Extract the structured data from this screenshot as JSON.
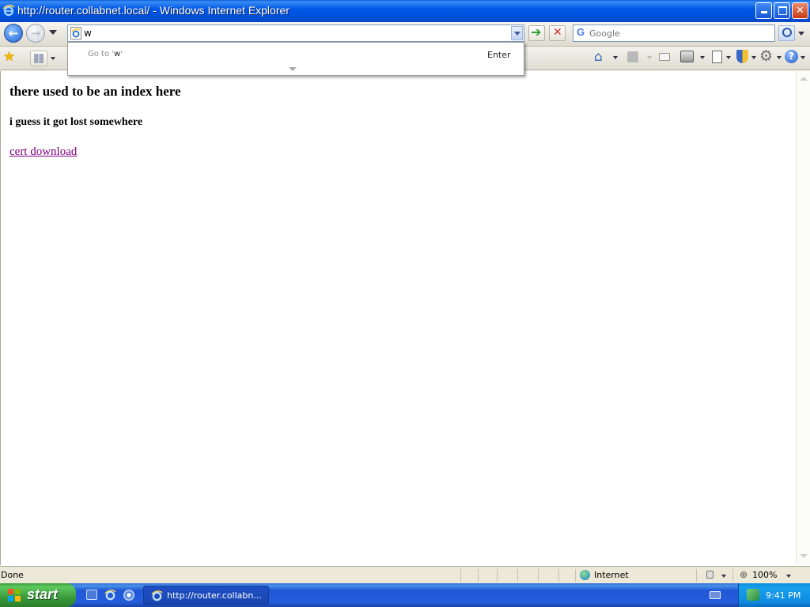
{
  "window": {
    "title": "http://router.collabnet.local/ - Windows Internet Explorer"
  },
  "address_bar": {
    "value": "w"
  },
  "search_box": {
    "placeholder": "Google"
  },
  "autocomplete": {
    "goto_prefix": "Go to '",
    "goto_value": "w",
    "goto_suffix": "'",
    "enter_label": "Enter"
  },
  "page": {
    "heading": "there used to be an index here",
    "subheading": "i guess it got lost somewhere",
    "link_text": "cert download"
  },
  "status_bar": {
    "status_text": "Done",
    "zone_label": "Internet",
    "zoom_label": "100%"
  },
  "taskbar": {
    "start_label": "start",
    "task_item_label": "http://router.collabn...",
    "clock": "9:41 PM"
  },
  "colors": {
    "visited_link": "#800080",
    "titlebar_blue": "#0058e6",
    "start_green": "#3a9a3a"
  }
}
